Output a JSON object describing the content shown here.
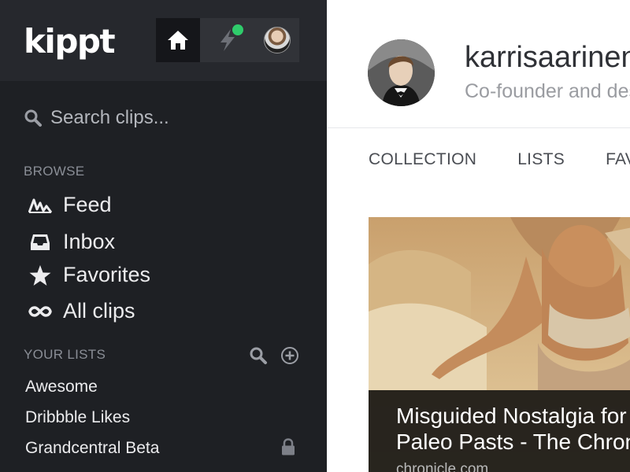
{
  "app": {
    "logo": "kippt"
  },
  "topnav": {
    "home_icon": "home-icon",
    "activity_icon": "bolt-icon",
    "notification_color": "#2fcc6b"
  },
  "search": {
    "placeholder": "Search clips..."
  },
  "browse": {
    "label": "BROWSE",
    "items": [
      {
        "label": "Feed",
        "icon": "feed-icon"
      },
      {
        "label": "Inbox",
        "icon": "inbox-icon"
      },
      {
        "label": "Favorites",
        "icon": "star-icon"
      },
      {
        "label": "All clips",
        "icon": "infinity-icon"
      }
    ]
  },
  "your_lists": {
    "label": "YOUR LISTS",
    "items": [
      {
        "label": "Awesome",
        "locked": false
      },
      {
        "label": "Dribbble Likes",
        "locked": false
      },
      {
        "label": "Grandcentral Beta",
        "locked": true
      }
    ]
  },
  "profile": {
    "username": "karrisaarinen",
    "bio": "Co-founder and designer"
  },
  "tabs": [
    "COLLECTION",
    "LISTS",
    "FAVORITES"
  ],
  "clip": {
    "title": "Misguided Nostalgia for\nPaleo Pasts - The Chronicle",
    "domain": "chronicle.com"
  },
  "colors": {
    "sidebar_bg": "#1e2024",
    "topbar_bg": "#26282d",
    "accent_green": "#2fcc6b"
  }
}
